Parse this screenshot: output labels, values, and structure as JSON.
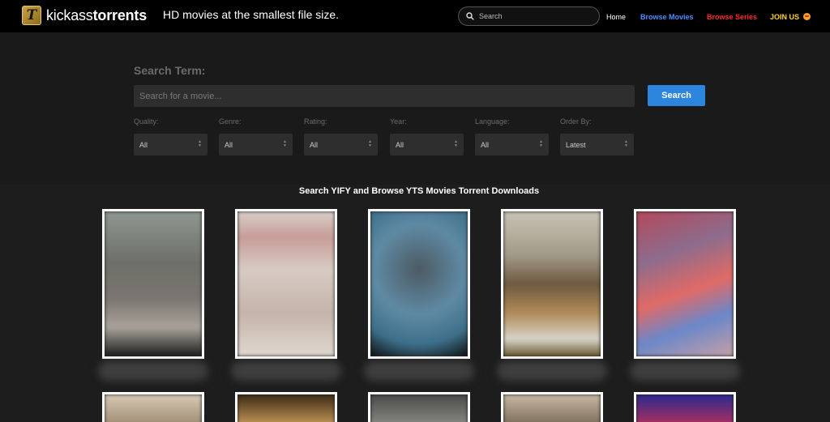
{
  "header": {
    "logo_letter": "T",
    "logo_prefix": "kickass",
    "logo_suffix": "torrents",
    "tagline": "HD movies at the smallest file size.",
    "search_placeholder": "Search",
    "nav": {
      "home": "Home",
      "browse_movies": "Browse Movies",
      "browse_series": "Browse Series",
      "join": "JOIN US"
    }
  },
  "search_panel": {
    "term_label": "Search Term:",
    "term_placeholder": "Search for a movie...",
    "search_button": "Search",
    "filters": [
      {
        "label": "Quality:",
        "value": "All"
      },
      {
        "label": "Genre:",
        "value": "All"
      },
      {
        "label": "Rating:",
        "value": "All"
      },
      {
        "label": "Year:",
        "value": "All"
      },
      {
        "label": "Language:",
        "value": "All"
      },
      {
        "label": "Order By:",
        "value": "Latest"
      }
    ]
  },
  "results": {
    "title": "Search YIFY and Browse YTS Movies Torrent Downloads"
  },
  "colors": {
    "accent_blue": "#2d86de",
    "nav_movies": "#4f8dff",
    "nav_series": "#ff2a2a",
    "nav_join": "#ffd12e"
  }
}
